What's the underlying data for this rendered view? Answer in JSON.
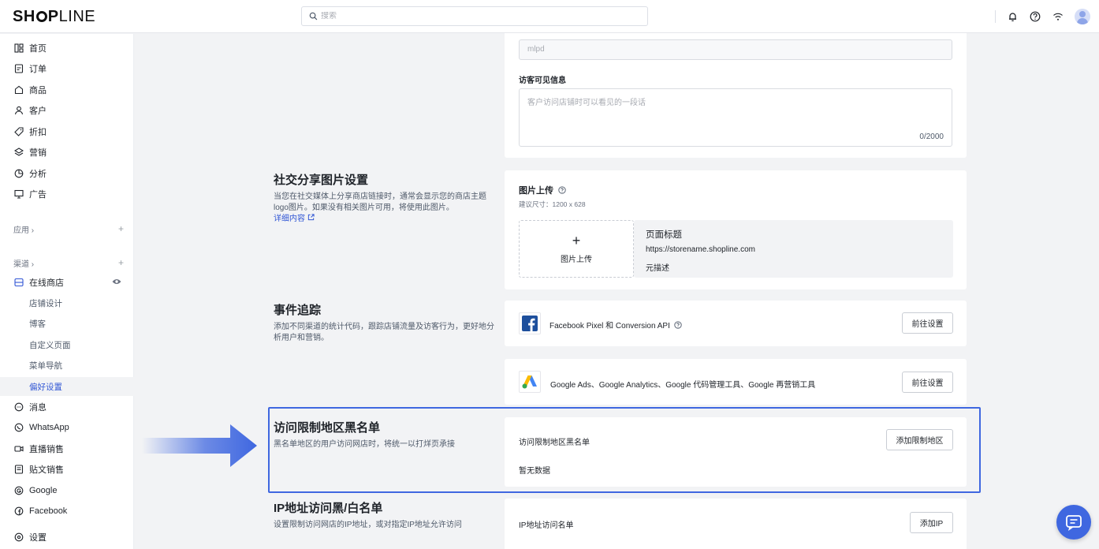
{
  "brand": {
    "logo_bold": "SH",
    "logo_mid": "P",
    "logo_light": "LINE"
  },
  "search": {
    "placeholder": "搜索"
  },
  "sidebar": {
    "items": [
      {
        "label": "首页",
        "icon": "home-icon"
      },
      {
        "label": "订单",
        "icon": "order-icon"
      },
      {
        "label": "商品",
        "icon": "product-icon"
      },
      {
        "label": "客户",
        "icon": "customer-icon"
      },
      {
        "label": "折扣",
        "icon": "discount-icon"
      },
      {
        "label": "营销",
        "icon": "marketing-icon"
      },
      {
        "label": "分析",
        "icon": "analytics-icon"
      },
      {
        "label": "广告",
        "icon": "ads-icon"
      }
    ],
    "apps_group": "应用 ›",
    "channels_group": "渠道 ›",
    "online_store": "在线商店",
    "sub_items": [
      "店铺设计",
      "博客",
      "自定义页面",
      "菜单导航",
      "偏好设置"
    ],
    "bottom_items": [
      {
        "label": "消息",
        "icon": "message-icon"
      },
      {
        "label": "WhatsApp",
        "icon": "whatsapp-icon"
      },
      {
        "label": "直播销售",
        "icon": "live-icon"
      },
      {
        "label": "贴文销售",
        "icon": "post-icon"
      },
      {
        "label": "Google",
        "icon": "google-icon"
      },
      {
        "label": "Facebook",
        "icon": "facebook-icon"
      },
      {
        "label": "设置",
        "icon": "settings-icon"
      }
    ]
  },
  "store_info": {
    "field_value": "mlpd",
    "visitor_info_label": "访客可见信息",
    "visitor_info_placeholder": "客户访问店铺时可以看见的一段话",
    "counter": "0/2000"
  },
  "social_share": {
    "title": "社交分享图片设置",
    "desc": "当您在社交媒体上分享商店链接时，通常会显示您的商店主题logo图片。如果没有相关图片可用，将使用此图片。",
    "link": "详细内容",
    "upload_label": "图片上传",
    "size_hint": "建议尺寸：1200 x 628",
    "upload_button": "图片上传",
    "preview_title": "页面标题",
    "preview_url": "https://storename.shopline.com",
    "preview_desc": "元描述"
  },
  "event_tracking": {
    "title": "事件追踪",
    "desc": "添加不同渠道的统计代码，跟踪店铺流量及访客行为，更好地分析用户和营销。",
    "fb_label": "Facebook Pixel 和 Conversion API",
    "google_label": "Google Ads、Google Analytics、Google 代码管理工具、Google 再营销工具",
    "goto_button": "前往设置"
  },
  "region_blacklist": {
    "title": "访问限制地区黑名单",
    "desc": "黑名单地区的用户访问网店时，将统一以打烊页承接",
    "card_label": "访问限制地区黑名单",
    "add_button": "添加限制地区",
    "empty": "暂无数据"
  },
  "ip_list": {
    "title": "IP地址访问黑/白名单",
    "desc": "设置限制访问网店的IP地址，或对指定IP地址允许访问",
    "card_label": "IP地址访问名单",
    "add_button": "添加IP"
  },
  "colors": {
    "accent": "#3f67e0",
    "link": "#3257d5",
    "background": "#f2f3f5"
  }
}
